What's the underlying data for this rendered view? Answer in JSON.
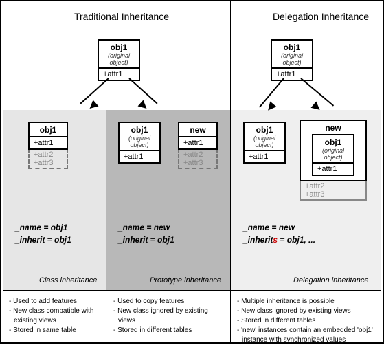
{
  "titles": {
    "left": "Traditional Inheritance",
    "right": "Delegation Inheritance"
  },
  "obj": {
    "name_obj1": "obj1",
    "name_new": "new",
    "original": "(original object)",
    "attr1": "+attr1",
    "attr2": "+attr2",
    "attr3": "+attr3"
  },
  "labels": {
    "class": {
      "l1": "_name = obj1",
      "l2": "_inherit = obj1"
    },
    "proto": {
      "l1": "_name = new",
      "l2": "_inherit = obj1"
    },
    "deleg": {
      "l1": "_name = new",
      "l2a": "_inherit",
      "l2b": "s",
      "l2c": " = obj1, ..."
    }
  },
  "cats": {
    "class": "Class inheritance",
    "proto": "Prototype inheritance",
    "deleg": "Delegation inheritance"
  },
  "notes": {
    "class": [
      "Used to add features",
      "New class compatible with existing views",
      "Stored in same table"
    ],
    "proto": [
      "Used to copy features",
      "New class ignored by existing views",
      "Stored in different tables"
    ],
    "deleg": [
      "Multiple inheritance is possible",
      "New class ignored by existing views",
      "Stored in different tables",
      "'new' instances contain an embedded 'obj1' instance with synchronized values"
    ]
  }
}
